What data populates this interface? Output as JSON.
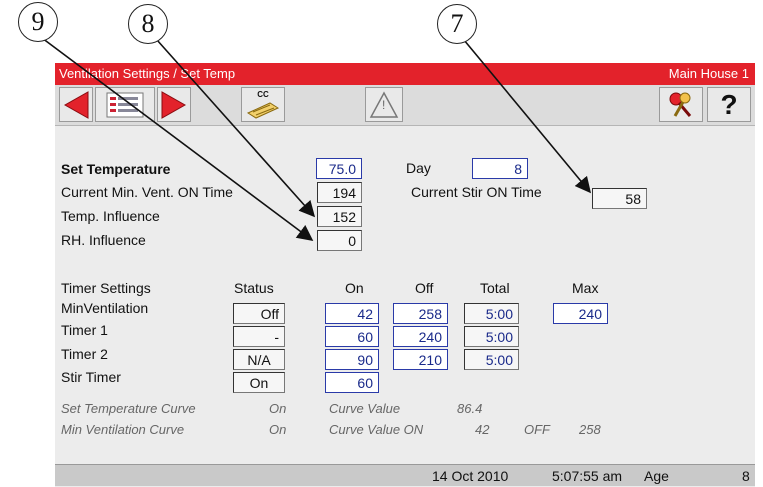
{
  "callouts": [
    "9",
    "8",
    "7"
  ],
  "titlebar": {
    "title": "Ventilation Settings / Set Temp",
    "house": "Main House 1"
  },
  "toolbar": {
    "back": "red-left-arrow-icon",
    "list": "list-view-icon",
    "forward": "red-right-arrow-icon",
    "cc_label": "CC",
    "alarm_symbol": "!",
    "help_symbol": "?"
  },
  "settings": {
    "set_temp_label": "Set Temperature",
    "set_temp_value": "75.0",
    "day_label": "Day",
    "day_value": "8",
    "min_vent_on_label": "Current Min. Vent. ON Time",
    "min_vent_on_value": "194",
    "stir_on_label": "Current Stir ON Time",
    "stir_on_value": "58",
    "temp_influence_label": "Temp. Influence",
    "temp_influence_value": "152",
    "rh_influence_label": "RH. Influence",
    "rh_influence_value": "0"
  },
  "timers": {
    "headers": {
      "name": "Timer Settings",
      "status": "Status",
      "on": "On",
      "off": "Off",
      "total": "Total",
      "max": "Max"
    },
    "rows": [
      {
        "name": "MinVentilation",
        "status": "Off",
        "on": "42",
        "off": "258",
        "total": "5:00",
        "max": "240"
      },
      {
        "name": "Timer 1",
        "status": "-",
        "on": "60",
        "off": "240",
        "total": "5:00"
      },
      {
        "name": "Timer 2",
        "status": "N/A",
        "on": "90",
        "off": "210",
        "total": "5:00"
      },
      {
        "name": "Stir Timer",
        "status": "On",
        "on": "60"
      }
    ]
  },
  "curves": {
    "set_temp_curve": "Set Temperature Curve",
    "set_temp_state": "On",
    "set_temp_value_label": "Curve Value",
    "set_temp_value": "86.4",
    "min_vent_curve": "Min Ventilation Curve",
    "min_vent_state": "On",
    "min_vent_on_label": "Curve Value ON",
    "min_vent_on_value": "42",
    "min_vent_off_label": "OFF",
    "min_vent_off_value": "258"
  },
  "statusbar": {
    "date": "14 Oct 2010",
    "time": "5:07:55 am",
    "age_label": "Age",
    "age_value": "8"
  },
  "colors": {
    "titlebar": "#e3222b",
    "edit_border": "#2a3aa8",
    "edit_text": "#1a2a8a"
  }
}
